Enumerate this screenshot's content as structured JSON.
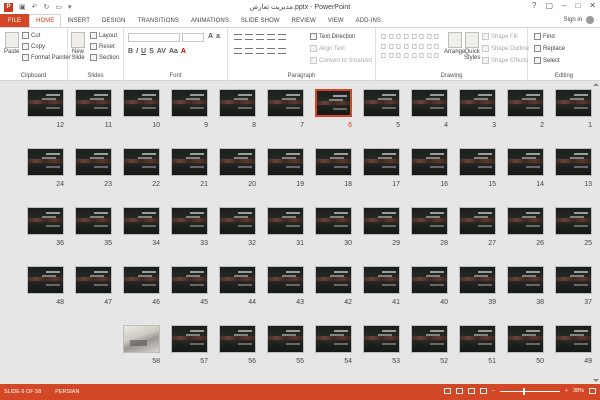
{
  "window": {
    "title": "مدیریت تعارض.pptx - PowerPoint",
    "app_icon": "P"
  },
  "quick_access": [
    "save-icon",
    "undo-icon",
    "redo-icon",
    "start-from-beginning-icon"
  ],
  "tabs": [
    "FILE",
    "HOME",
    "INSERT",
    "DESIGN",
    "TRANSITIONS",
    "ANIMATIONS",
    "SLIDE SHOW",
    "REVIEW",
    "VIEW",
    "ADD-INS"
  ],
  "active_tab": "HOME",
  "sign_in": "Sign in",
  "ribbon": {
    "clipboard": {
      "label": "Clipboard",
      "paste": "Paste",
      "cut": "Cut",
      "copy": "Copy",
      "format_painter": "Format Painter"
    },
    "slides": {
      "label": "Slides",
      "new_slide_1": "New",
      "new_slide_2": "Slide",
      "layout": "Layout",
      "reset": "Reset",
      "section": "Section"
    },
    "font": {
      "label": "Font"
    },
    "paragraph": {
      "label": "Paragraph",
      "text_direction": "Text Direction",
      "align_text": "Align Text",
      "convert_smartart": "Convert to SmartArt"
    },
    "drawing": {
      "label": "Drawing",
      "arrange": "Arrange",
      "quick_styles_1": "Quick",
      "quick_styles_2": "Styles",
      "shape_fill": "Shape Fill",
      "shape_outline": "Shape Outline",
      "shape_effects": "Shape Effects"
    },
    "editing": {
      "label": "Editing",
      "find": "Find",
      "replace": "Replace",
      "select": "Select"
    }
  },
  "slides": {
    "total": 58,
    "selected": 6,
    "photo_slide": 58
  },
  "status": {
    "slide_count": "SLIDE 6 OF 58",
    "language": "PERSIAN",
    "zoom": "38%",
    "zoom_fraction": 0.38
  }
}
